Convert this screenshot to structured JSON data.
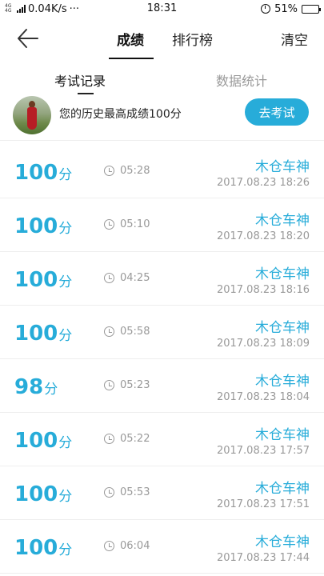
{
  "status_bar": {
    "network_type": "4G 4G",
    "speed": "0.04K/s",
    "more": "···",
    "time": "18:31",
    "battery_text": "51%",
    "battery_level": 0.51
  },
  "header": {
    "tab_grade": "成绩",
    "tab_rank": "排行榜",
    "clear": "清空"
  },
  "subtabs": {
    "exam_records": "考试记录",
    "data_stats": "数据统计"
  },
  "best": {
    "text": "您的历史最高成绩100分",
    "button": "去考试"
  },
  "colors": {
    "accent": "#27acd9",
    "muted": "#999999"
  },
  "records": [
    {
      "score": "100",
      "unit": "分",
      "duration": "05:28",
      "user": "木仓车神",
      "datetime": "2017.08.23  18:26"
    },
    {
      "score": "100",
      "unit": "分",
      "duration": "05:10",
      "user": "木仓车神",
      "datetime": "2017.08.23  18:20"
    },
    {
      "score": "100",
      "unit": "分",
      "duration": "04:25",
      "user": "木仓车神",
      "datetime": "2017.08.23  18:16"
    },
    {
      "score": "100",
      "unit": "分",
      "duration": "05:58",
      "user": "木仓车神",
      "datetime": "2017.08.23  18:09"
    },
    {
      "score": "98",
      "unit": "分",
      "duration": "05:23",
      "user": "木仓车神",
      "datetime": "2017.08.23  18:04"
    },
    {
      "score": "100",
      "unit": "分",
      "duration": "05:22",
      "user": "木仓车神",
      "datetime": "2017.08.23  17:57"
    },
    {
      "score": "100",
      "unit": "分",
      "duration": "05:53",
      "user": "木仓车神",
      "datetime": "2017.08.23  17:51"
    },
    {
      "score": "100",
      "unit": "分",
      "duration": "06:04",
      "user": "木仓车神",
      "datetime": "2017.08.23  17:44"
    }
  ]
}
